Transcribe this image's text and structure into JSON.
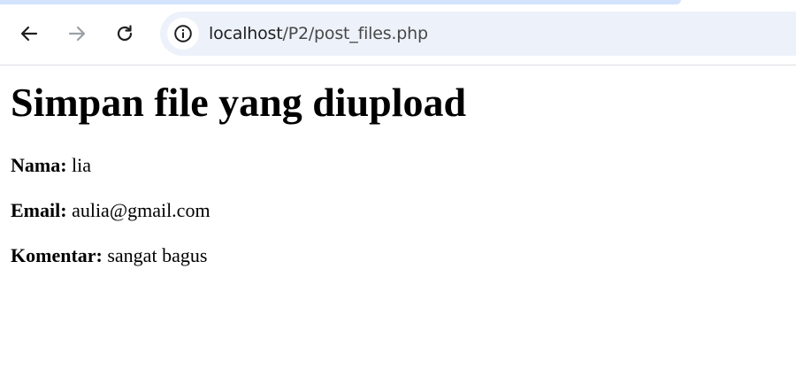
{
  "browser": {
    "url_host": "localhost",
    "url_path": "/P2/post_files.php",
    "icons": {
      "back": "arrow-left-icon",
      "forward": "arrow-right-icon",
      "reload": "reload-icon",
      "site_info": "info-circle-icon"
    },
    "colors": {
      "omnibox_bg": "#edf2fa",
      "tab_strip": "#d3e3fd"
    }
  },
  "page": {
    "title": "Simpan file yang diupload",
    "fields": [
      {
        "label": "Nama:",
        "value": "lia"
      },
      {
        "label": "Email:",
        "value": "aulia@gmail.com"
      },
      {
        "label": "Komentar:",
        "value": "sangat bagus"
      }
    ]
  }
}
